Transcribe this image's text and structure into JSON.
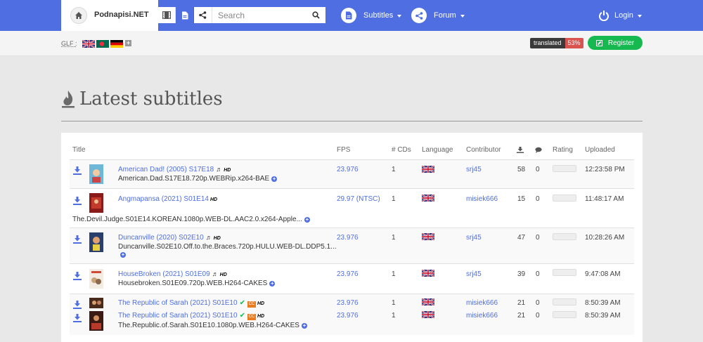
{
  "navbar": {
    "brand": "Podnapisi.NET",
    "search_placeholder": "Search",
    "subtitles_label": "Subtitles",
    "forum_label": "Forum",
    "login_label": "Login"
  },
  "subbar": {
    "glf_label": "GLF :",
    "translated_label": "translated",
    "translated_pct": "53%",
    "register_label": "Register"
  },
  "page": {
    "heading": "Latest subtitles"
  },
  "table": {
    "headers": {
      "title": "Title",
      "fps": "FPS",
      "cds": "# CDs",
      "language": "Language",
      "contributor": "Contributor",
      "rating": "Rating",
      "uploaded": "Uploaded"
    },
    "rows": [
      {
        "title": "American Dad! (2005) S17E18",
        "release": "American.Dad.S17E18.720p.WEBRip.x264-BAE",
        "fps": "23.976",
        "cds": "1",
        "contributor": "srj45",
        "downloads": "58",
        "comments": "0",
        "uploaded": "12:23:58 PM",
        "hd": "HD"
      },
      {
        "title": "Angmapansa (2021) S01E14",
        "release": "The.Devil.Judge.S01E14.KOREAN.1080p.WEB-DL.AAC2.0.x264-Apple...",
        "fps": "29.97 (NTSC)",
        "cds": "1",
        "contributor": "misiek666",
        "downloads": "15",
        "comments": "0",
        "uploaded": "11:48:17 AM",
        "hd": "HD"
      },
      {
        "title": "Duncanville (2020) S02E10",
        "release": "Duncanville.S02E10.Off.to.the.Braces.720p.HULU.WEB-DL.DDP5.1...",
        "fps": "23.976",
        "cds": "1",
        "contributor": "srj45",
        "downloads": "47",
        "comments": "0",
        "uploaded": "10:28:26 AM",
        "hd": "HD"
      },
      {
        "title": "HouseBroken (2021) S01E09",
        "release": "Housebroken.S01E09.720p.WEB.H264-CAKES",
        "fps": "23.976",
        "cds": "1",
        "contributor": "srj45",
        "downloads": "39",
        "comments": "0",
        "uploaded": "9:47:08 AM",
        "hd": "HD"
      },
      {
        "title": "The Republic of Sarah (2021) S01E10",
        "release": "",
        "fps": "23.976",
        "cds": "1",
        "contributor": "misiek666",
        "downloads": "21",
        "comments": "0",
        "uploaded": "8:50:39 AM",
        "hd": "HD"
      },
      {
        "title": "The Republic of Sarah (2021) S01E10",
        "release": "The.Republic.of.Sarah.S01E10.1080p.WEB.H264-CAKES",
        "fps": "23.976",
        "cds": "1",
        "contributor": "misiek666",
        "downloads": "21",
        "comments": "0",
        "uploaded": "8:50:39 AM",
        "hd": "HD"
      }
    ]
  },
  "colors": {
    "accent": "#4e6ee1",
    "register": "#15b94f",
    "translated_pct": "#d9534f"
  }
}
